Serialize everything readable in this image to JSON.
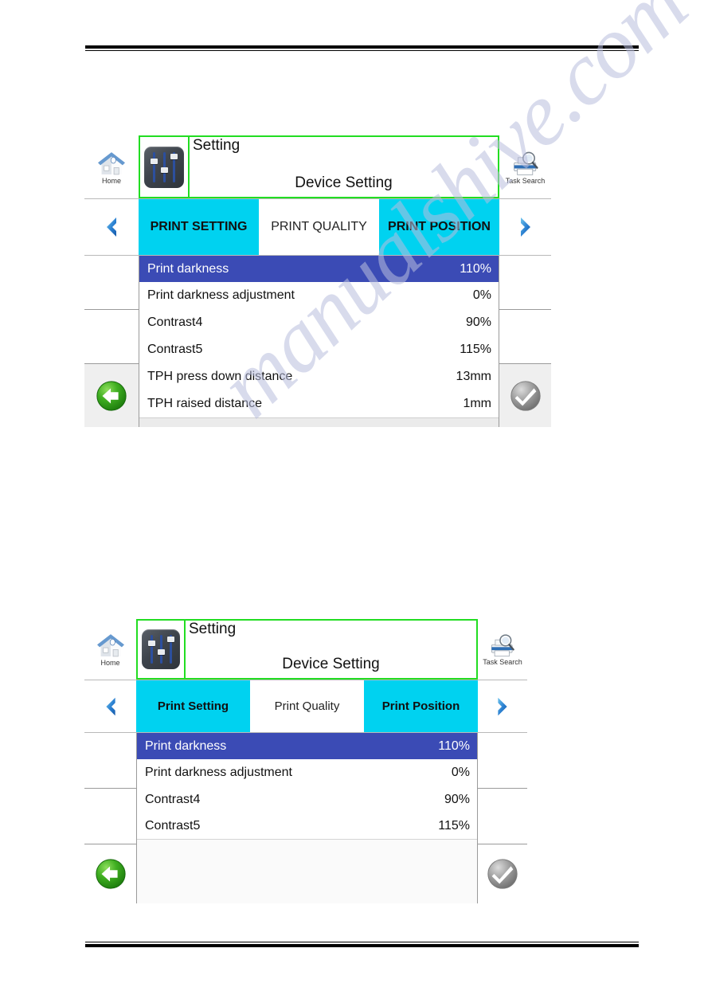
{
  "watermark": {
    "text": "manualshive.com"
  },
  "panels": [
    {
      "id": "panel-top",
      "header": {
        "home": {
          "label": "Home",
          "icon": "home-icon"
        },
        "app_icon": "settings-sliders-icon",
        "title_small": "Setting",
        "title_main": "Device Setting",
        "task_search": {
          "label": "Task Search",
          "icon": "printer-search-icon"
        }
      },
      "nav": {
        "prev_icon": "chevron-left-icon",
        "next_icon": "chevron-right-icon",
        "back_icon": "back-arrow-icon",
        "confirm_icon": "check-circle-icon"
      },
      "tabs": [
        {
          "label": "PRINT SETTING",
          "active": true
        },
        {
          "label": "PRINT QUALITY",
          "active": false
        },
        {
          "label": "PRINT POSITION",
          "active": true
        }
      ],
      "rows": [
        {
          "label": "Print darkness",
          "value": "110%",
          "selected": true
        },
        {
          "label": "Print darkness adjustment",
          "value": "0%",
          "selected": false
        },
        {
          "label": "Contrast4",
          "value": "90%",
          "selected": false
        },
        {
          "label": "Contrast5",
          "value": "115%",
          "selected": false
        },
        {
          "label": "TPH press down distance",
          "value": "13mm",
          "selected": false
        },
        {
          "label": "TPH raised distance",
          "value": "1mm",
          "selected": false
        }
      ]
    },
    {
      "id": "panel-bottom",
      "header": {
        "home": {
          "label": "Home",
          "icon": "home-icon"
        },
        "app_icon": "settings-sliders-icon",
        "title_small": "Setting",
        "title_main": "Device Setting",
        "task_search": {
          "label": "Task Search",
          "icon": "printer-search-icon"
        }
      },
      "nav": {
        "prev_icon": "chevron-left-icon",
        "next_icon": "chevron-right-icon",
        "back_icon": "back-arrow-icon",
        "confirm_icon": "check-circle-icon"
      },
      "tabs": [
        {
          "label": "Print Setting",
          "active": true
        },
        {
          "label": "Print Quality",
          "active": false
        },
        {
          "label": "Print Position",
          "active": true
        }
      ],
      "rows": [
        {
          "label": "Print darkness",
          "value": "110%",
          "selected": true
        },
        {
          "label": "Print darkness adjustment",
          "value": "0%",
          "selected": false
        },
        {
          "label": "Contrast4",
          "value": "90%",
          "selected": false
        },
        {
          "label": "Contrast5",
          "value": "115%",
          "selected": false
        }
      ]
    }
  ],
  "colors": {
    "tab_active": "#00d2f0",
    "tab_inactive": "#ffffff",
    "row_selected": "#3b4bb5",
    "frame_highlight": "#22dd22",
    "back_button": "#2a9c18",
    "confirm_button": "#9a9a9a"
  }
}
